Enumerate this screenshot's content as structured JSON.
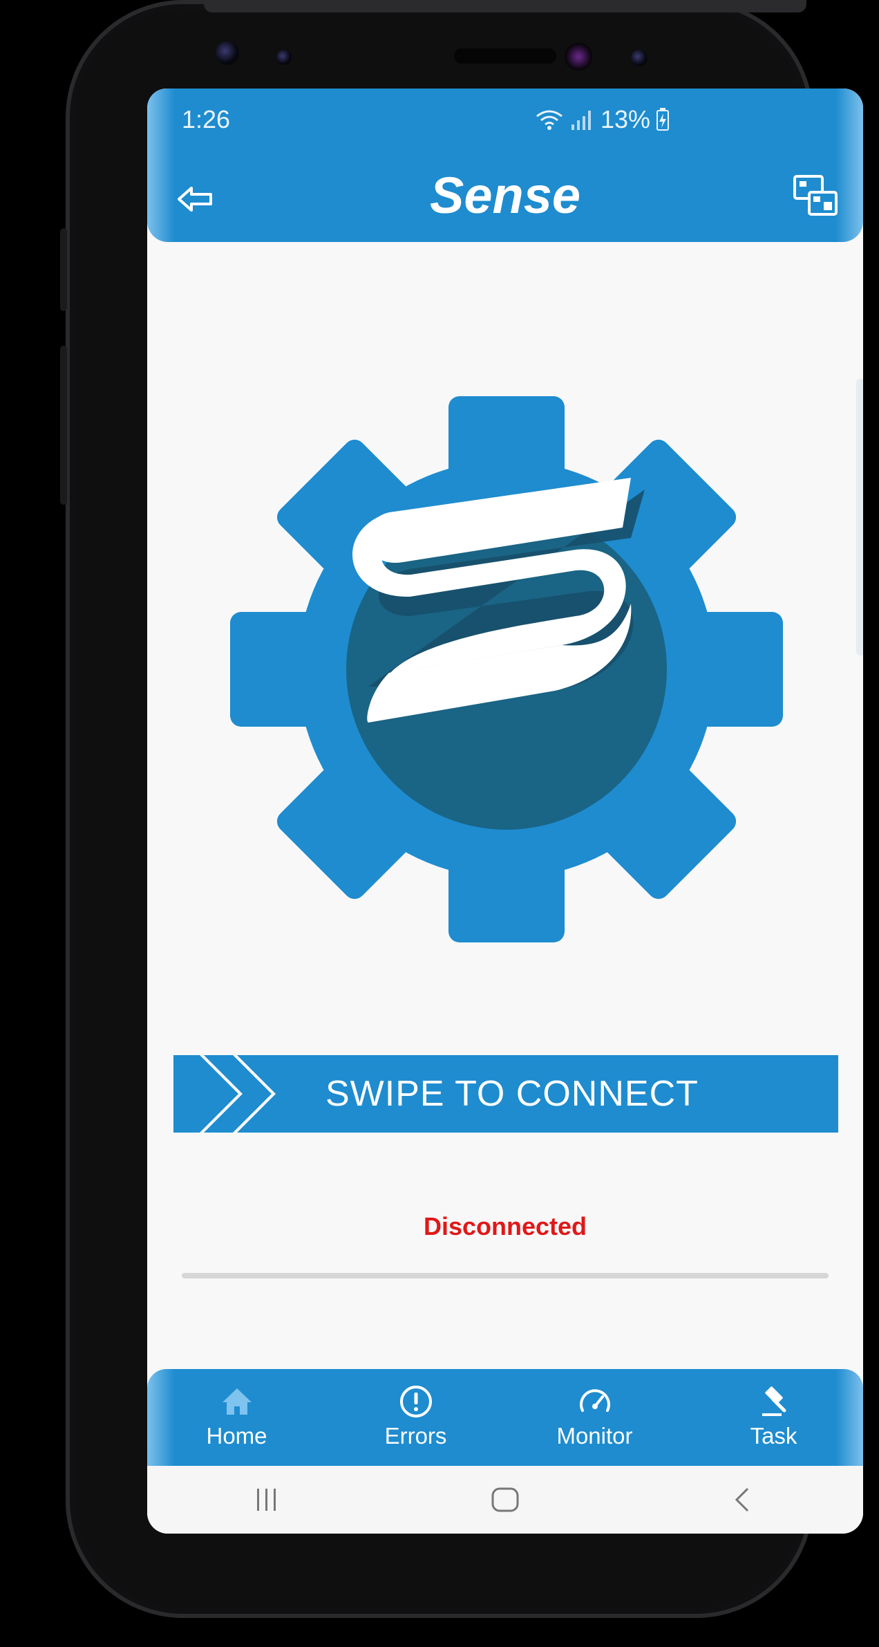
{
  "status_bar": {
    "time": "1:26",
    "battery": "13%"
  },
  "app_bar": {
    "title": "Sense",
    "back_icon": "back-arrow-icon",
    "switch_icon": "window-switch-icon"
  },
  "logo": {
    "icon": "gear-s-logo-icon",
    "colors": {
      "gear": "#1e8ccf",
      "inner_circle": "#1a6485",
      "letter": "#ffffff"
    }
  },
  "swipe": {
    "label": "SWIPE TO CONNECT",
    "icon": "double-chevron-right-icon"
  },
  "connection": {
    "status": "Disconnected",
    "status_color": "#e01818"
  },
  "bottom_nav": {
    "items": [
      {
        "label": "Home",
        "icon": "home-icon"
      },
      {
        "label": "Errors",
        "icon": "alert-circle-icon"
      },
      {
        "label": "Monitor",
        "icon": "speedometer-icon"
      },
      {
        "label": "Task",
        "icon": "hammer-icon"
      }
    ]
  },
  "system_nav": {
    "icons": [
      "recent-apps-icon",
      "home-circle-icon",
      "back-chevron-icon"
    ]
  },
  "colors": {
    "primary": "#1e8ccf",
    "background": "#f8f8f9"
  }
}
